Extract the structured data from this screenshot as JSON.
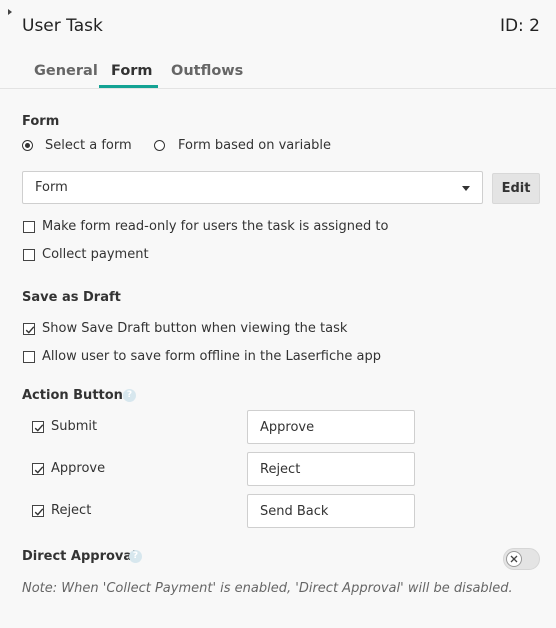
{
  "header": {
    "title": "User Task",
    "id_label": "ID: 2"
  },
  "tabs": [
    {
      "label": "General",
      "active": false
    },
    {
      "label": "Form",
      "active": true
    },
    {
      "label": "Outflows",
      "active": false
    }
  ],
  "accent_color": "#14a394",
  "form_section": {
    "heading": "Form",
    "radio_select_form": {
      "label": "Select a form",
      "checked": true
    },
    "radio_variable": {
      "label": "Form based on variable",
      "checked": false
    },
    "selected_form": "Form",
    "edit_label": "Edit",
    "readonly_checkbox": {
      "label": "Make form read-only for users the task is assigned to",
      "checked": false
    },
    "payment_checkbox": {
      "label": "Collect payment",
      "checked": false
    }
  },
  "draft_section": {
    "heading": "Save as Draft",
    "show_draft": {
      "label": "Show Save Draft button when viewing the task",
      "checked": true
    },
    "offline": {
      "label": "Allow user to save form offline in the Laserfiche app",
      "checked": false
    }
  },
  "action_buttons": {
    "heading": "Action Buttons",
    "help_icon": "question-circle-icon",
    "items": [
      {
        "label": "Submit",
        "checked": true,
        "value": "Approve"
      },
      {
        "label": "Approve",
        "checked": true,
        "value": "Reject"
      },
      {
        "label": "Reject",
        "checked": true,
        "value": "Send Back"
      }
    ]
  },
  "direct_approval": {
    "heading": "Direct Approval",
    "help_icon": "question-circle-icon",
    "enabled": false,
    "note": "Note: When 'Collect Payment' is enabled, 'Direct Approval' will be disabled."
  }
}
